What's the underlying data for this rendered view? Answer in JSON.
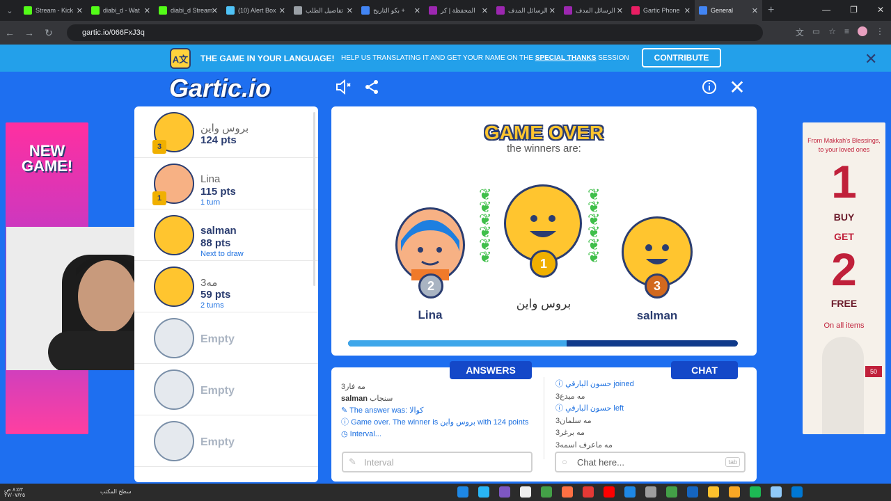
{
  "browser": {
    "tabs": [
      {
        "label": "Stream - Kick",
        "color": "#53fc18"
      },
      {
        "label": "diabi_d - Wat",
        "color": "#53fc18"
      },
      {
        "label": "diabi_d Stream",
        "color": "#53fc18"
      },
      {
        "label": "(10) Alert Box",
        "color": "#4fc3f7"
      },
      {
        "label": "تفاصيل الطلب",
        "color": "#9aa0a6"
      },
      {
        "label": "بكو التاريخ +",
        "color": "#4285f4"
      },
      {
        "label": "المحفظة | كر",
        "color": "#9c27b0"
      },
      {
        "label": "الرسائل المدف",
        "color": "#9c27b0"
      },
      {
        "label": "الرسائل المدف",
        "color": "#9c27b0"
      },
      {
        "label": "Gartic Phone",
        "color": "#e91e63"
      },
      {
        "label": "General",
        "color": "#4285f4"
      }
    ],
    "url": "gartic.io/066FxJ3q"
  },
  "banner": {
    "lang_icon": "A文",
    "headline": "THE GAME IN YOUR LANGUAGE!",
    "text_pre": "HELP US TRANSLATING IT AND GET YOUR NAME ON THE",
    "text_link": "SPECIAL THANKS",
    "text_post": "SESSION",
    "contribute": "CONTRIBUTE"
  },
  "header": {
    "logo": "Gartic.io",
    "sound_icon": "sound-icon",
    "share_icon": "share-icon",
    "info_icon": "info-icon",
    "close_icon": "close-icon"
  },
  "players": [
    {
      "name": "بروس واين",
      "pts": "124 pts",
      "turn": "",
      "trophy": "3",
      "avatar": "yellow"
    },
    {
      "name": "Lina",
      "pts": "115 pts",
      "turn": "1 turn",
      "trophy": "1",
      "avatar": "blue"
    },
    {
      "name": "salman",
      "pts": "88 pts",
      "turn": "Next to draw",
      "trophy": "",
      "avatar": "yellow"
    },
    {
      "name": "مه3",
      "pts": "59 pts",
      "turn": "2 turns",
      "trophy": "",
      "avatar": "yellow"
    },
    {
      "name": "Empty",
      "pts": "",
      "turn": "",
      "trophy": "",
      "avatar": "empty"
    },
    {
      "name": "Empty",
      "pts": "",
      "turn": "",
      "trophy": "",
      "avatar": "empty"
    },
    {
      "name": "Empty",
      "pts": "",
      "turn": "",
      "trophy": "",
      "avatar": "empty"
    }
  ],
  "game_over": {
    "title": "GAME OVER",
    "subtitle": "the winners are:",
    "first": {
      "name": "بروس واين",
      "medal": "1"
    },
    "second": {
      "name": "Lina",
      "medal": "2"
    },
    "third": {
      "name": "salman",
      "medal": "3"
    },
    "progress": 0.56
  },
  "answers": {
    "tab": "ANSWERS",
    "lines": [
      {
        "text": "مه فار3",
        "kind": "plain"
      },
      {
        "text": "سنجاب",
        "kind": "name",
        "name": "salman"
      },
      {
        "text": "The answer was: كوالا",
        "kind": "blue",
        "icon": "pencil-icon"
      },
      {
        "text": "Game over. The winner is بروس واين with 124 points",
        "kind": "blue",
        "icon": "info-icon"
      },
      {
        "text": "Interval...",
        "kind": "blue",
        "icon": "clock-icon"
      }
    ],
    "placeholder": "Interval"
  },
  "chat": {
    "tab": "CHAT",
    "lines": [
      {
        "text": "حسون البارقي joined",
        "kind": "blue"
      },
      {
        "text": "مه ميدع3",
        "kind": "plain"
      },
      {
        "text": "حسون البارقي left",
        "kind": "blue"
      },
      {
        "text": "مه سلمان3",
        "kind": "plain"
      },
      {
        "text": "مه برغر3",
        "kind": "plain"
      },
      {
        "text": "مه ماعرف اسمه3",
        "kind": "plain"
      }
    ],
    "placeholder": "Chat here...",
    "tab_key": "tab"
  },
  "ads": {
    "left_text": "NEW GAME!",
    "right_line1": "From Makkah's Blessings, to your loved ones",
    "right_buy_num": "1",
    "right_buy": "BUY",
    "right_get": "GET",
    "right_free_num": "2",
    "right_free": "FREE",
    "right_items": "On all items",
    "right_badge": "50"
  },
  "taskbar": {
    "clock_time": "٨:٥٣ ص",
    "clock_date": "٢٧/٠٧/٢٥",
    "desktop_label": "سطح المكتب"
  }
}
